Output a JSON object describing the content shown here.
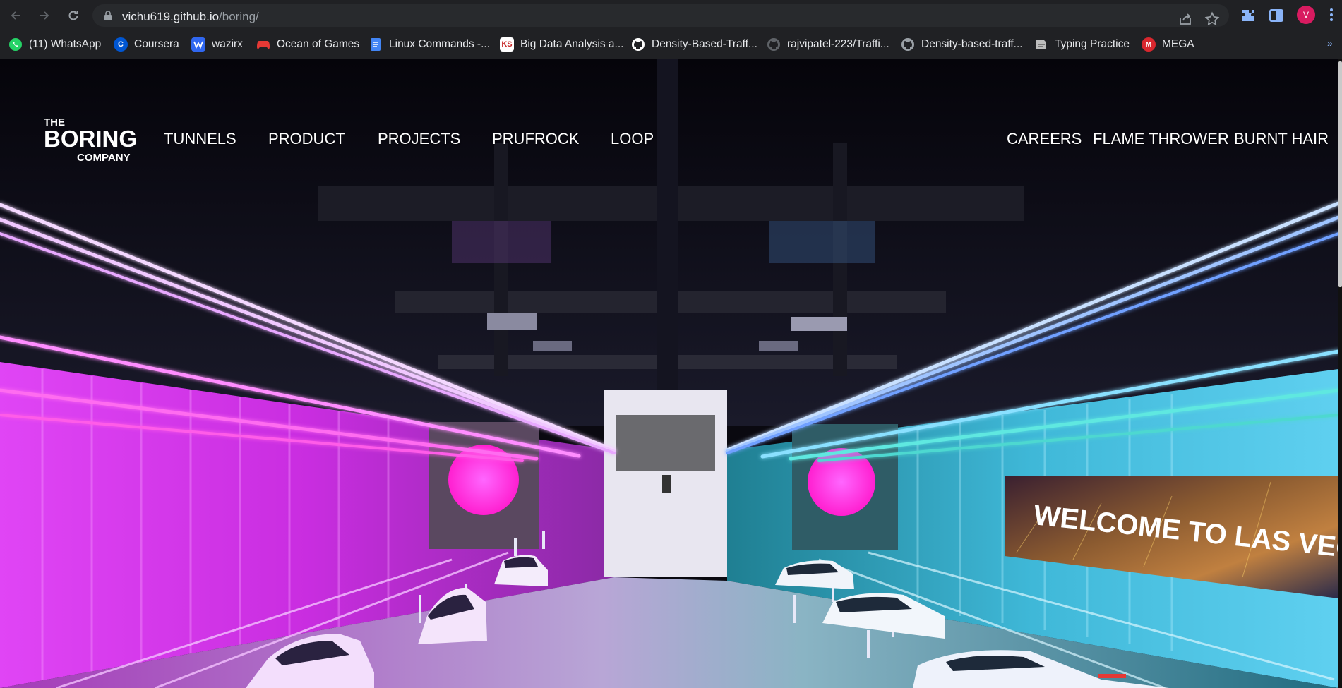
{
  "browser": {
    "url_host": "vichu619.github.io",
    "url_path": "/boring/",
    "profile_initial": "V",
    "accent_color": "#8ab4f8",
    "profile_color": "#d81b60"
  },
  "bookmarks": [
    {
      "label": "(11) WhatsApp",
      "icon": "whatsapp-icon",
      "color": "#25d366"
    },
    {
      "label": "Coursera",
      "icon": "coursera-icon",
      "color": "#0056d2"
    },
    {
      "label": "wazirx",
      "icon": "wazirx-icon",
      "color": "#3067f0"
    },
    {
      "label": "Ocean of Games",
      "icon": "gamepad-icon",
      "color": "#e53935"
    },
    {
      "label": "Linux Commands -...",
      "icon": "docs-icon",
      "color": "#4285f4"
    },
    {
      "label": "Big Data Analysis a...",
      "icon": "ks-icon",
      "color": "#ffffff"
    },
    {
      "label": "Density-Based-Traff...",
      "icon": "github-icon",
      "color": "#ffffff"
    },
    {
      "label": "rajvipatel-223/Traffi...",
      "icon": "github-icon",
      "color": "#5f6368"
    },
    {
      "label": "Density-based-traff...",
      "icon": "github-icon",
      "color": "#9aa0a6"
    },
    {
      "label": "Typing Practice",
      "icon": "typing-icon",
      "color": "#bdbdbd"
    },
    {
      "label": "MEGA",
      "icon": "mega-icon",
      "color": "#d9272e"
    }
  ],
  "site": {
    "logo": {
      "line1": "THE",
      "line2": "BORING",
      "line3": "COMPANY"
    },
    "nav_left": [
      "TUNNELS",
      "PRODUCT",
      "PROJECTS",
      "PRUFROCK",
      "LOOP"
    ],
    "nav_right": [
      "CAREERS",
      "FLAME THROWER",
      "BURNT HAIR"
    ]
  },
  "hero": {
    "sign_text": "WELCOME TO LAS VEGA",
    "colors": {
      "left_wall": "#e040fb",
      "right_wall": "#4fc3f7",
      "magenta_light": "#ff4dff",
      "blue_light": "#3d7bff",
      "cyan_light": "#4dd0e1"
    }
  }
}
